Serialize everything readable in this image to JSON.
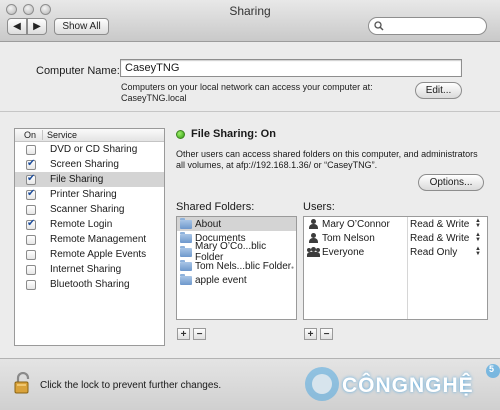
{
  "window": {
    "title": "Sharing",
    "show_all_label": "Show All",
    "search_placeholder": ""
  },
  "computer": {
    "name_label": "Computer Name:",
    "name_value": "CaseyTNG",
    "access_note_line1": "Computers on your local network can access your computer at:",
    "access_note_line2": "CaseyTNG.local",
    "edit_label": "Edit..."
  },
  "services": {
    "header_on": "On",
    "header_service": "Service",
    "items": [
      {
        "label": "DVD or CD Sharing",
        "checked": false
      },
      {
        "label": "Screen Sharing",
        "checked": true
      },
      {
        "label": "File Sharing",
        "checked": true,
        "selected": true
      },
      {
        "label": "Printer Sharing",
        "checked": true
      },
      {
        "label": "Scanner Sharing",
        "checked": false
      },
      {
        "label": "Remote Login",
        "checked": true
      },
      {
        "label": "Remote Management",
        "checked": false
      },
      {
        "label": "Remote Apple Events",
        "checked": false
      },
      {
        "label": "Internet Sharing",
        "checked": false
      },
      {
        "label": "Bluetooth Sharing",
        "checked": false
      }
    ]
  },
  "file_sharing": {
    "status": "File Sharing: On",
    "status_color": "#2f9b10",
    "description_line1": "Other users can access shared folders on this computer, and administrators",
    "description_line2": "all volumes, at afp://192.168.1.36/ or “CaseyTNG”.",
    "options_label": "Options..."
  },
  "shared_folders": {
    "label": "Shared Folders:",
    "items": [
      {
        "name": "About",
        "selected": true
      },
      {
        "name": "Documents"
      },
      {
        "name": "Mary O’Co...blic Folder"
      },
      {
        "name": "Tom Nels...blic Folder"
      },
      {
        "name": "apple event"
      }
    ]
  },
  "users": {
    "label": "Users:",
    "items": [
      {
        "name": "Mary O’Connor",
        "permission": "Read & Write",
        "icon": "user-icon"
      },
      {
        "name": "Tom Nelson",
        "permission": "Read & Write",
        "icon": "user-icon"
      },
      {
        "name": "Everyone",
        "permission": "Read Only",
        "icon": "group-icon"
      }
    ]
  },
  "controls": {
    "add": "+",
    "remove": "−"
  },
  "footer": {
    "lock_text": "Click the lock to prevent further changes.",
    "watermark_text": "CÔNGNGHỆ",
    "watermark_number": "5"
  },
  "colors": {
    "accent_blue": "#1f4f9c",
    "selection_gray": "#d4d4d4",
    "watermark_blue": "#4fa7e0"
  }
}
